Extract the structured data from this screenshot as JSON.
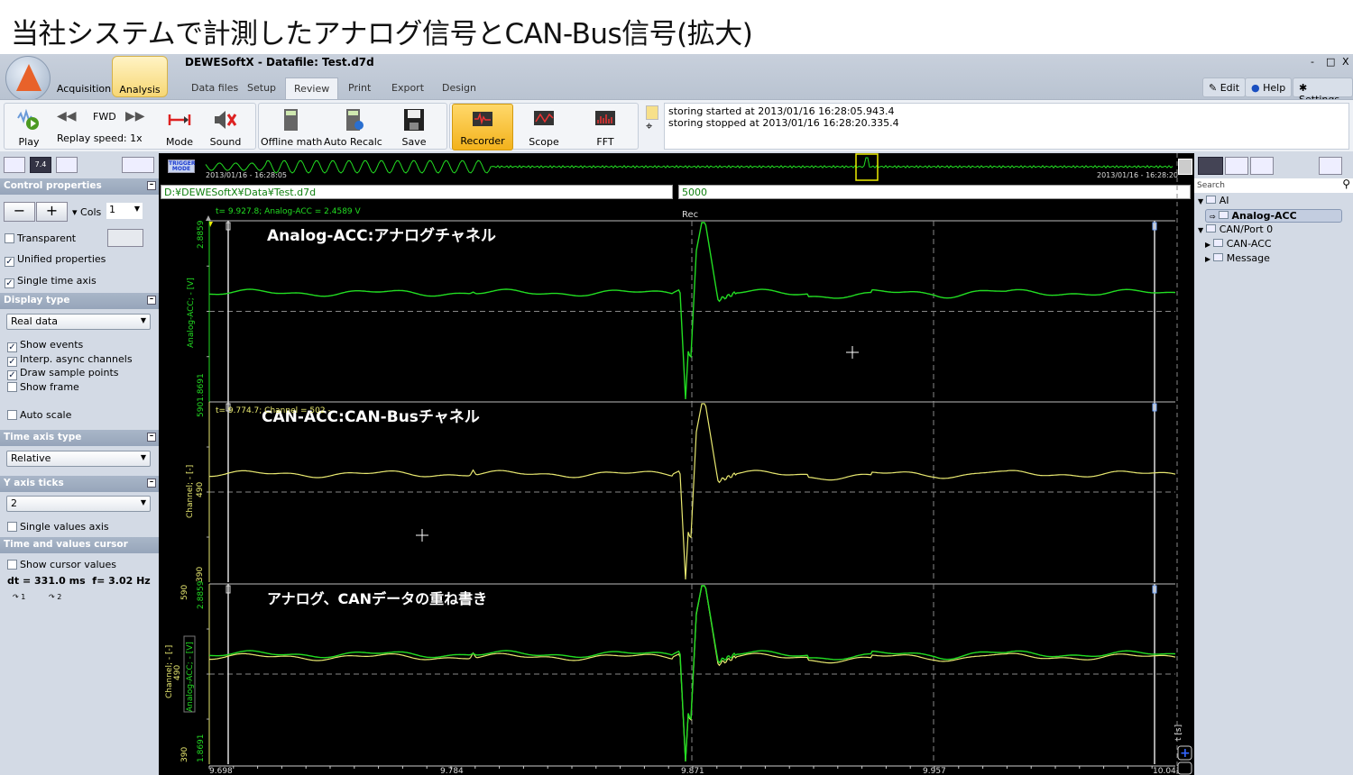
{
  "slide_title": "当社システムで計測したアナログ信号とCAN-Bus信号(拡大)",
  "app": {
    "title": "DEWESoftX - Datafile: Test.d7d",
    "modes": [
      "Acquisition",
      "Analysis"
    ],
    "tabs": [
      "Data files",
      "Setup",
      "Review",
      "Print",
      "Export",
      "Design"
    ],
    "active_tab": "Review",
    "window_controls": [
      "-",
      "□",
      "X"
    ],
    "right_buttons": [
      "Edit",
      "Help",
      "Settings"
    ]
  },
  "toolbar": {
    "play": "Play",
    "fwd": "FWD",
    "replay_speed": "Replay speed: 1x",
    "mode": "Mode",
    "sound": "Sound",
    "offline_math": "Offline math",
    "auto_recalc": "Auto Recalc",
    "save": "Save",
    "recorder": "Recorder",
    "scope": "Scope",
    "fft": "FFT"
  },
  "log": [
    "storing started at 2013/01/16 16:28:05.943.4",
    "storing stopped at 2013/01/16 16:28:20.335.4"
  ],
  "left": {
    "control_properties": "Control properties",
    "cols_label": "Cols",
    "cols_value": "1",
    "transparent": "Transparent",
    "unified": "Unified properties",
    "single_time": "Single time axis",
    "display_type": "Display type",
    "display_value": "Real data",
    "show_events": "Show events",
    "interp": "Interp. async channels",
    "draw_points": "Draw sample points",
    "show_frame": "Show frame",
    "auto_scale": "Auto scale",
    "time_axis_type": "Time axis type",
    "time_axis_value": "Relative",
    "y_axis_ticks": "Y axis ticks",
    "y_ticks_value": "2",
    "single_values": "Single values axis",
    "cursor_section": "Time and values cursor",
    "show_cursor": "Show cursor values",
    "dt": "dt = 331.0 ms  f= 3.02 Hz",
    "cursor1": "1",
    "cursor2": "2"
  },
  "checks": {
    "transparent": false,
    "unified": true,
    "single_time": true,
    "show_events": true,
    "interp": true,
    "draw_points": true,
    "show_frame": false,
    "auto_scale": false,
    "single_values": false,
    "show_cursor": false
  },
  "overview": {
    "trigger": "TRIGGER MODE",
    "start": "2013/01/16 - 16:28:05",
    "end": "2013/01/16 - 16:28:20"
  },
  "path": "D:¥DEWESoftX¥Data¥Test.d7d",
  "path_value": "5000",
  "panels": [
    {
      "title": "Analog-ACC:アナログチャネル",
      "readout": "t= 9.927.8; Analog-ACC = 2.4589 V",
      "ylabel": "Analog-ACC; - [V]",
      "ymax": "2.8859",
      "ymin": "5901.8691",
      "rec": "Rec"
    },
    {
      "title": "CAN-ACC:CAN-Busチャネル",
      "readout": "t= 9.774.7; Channel = 502 -",
      "ylabel": "Channel; - [-]",
      "ymid": "490",
      "ymin": "390"
    },
    {
      "title": "アナログ、CANデータの重ね書き",
      "ylabel1": "Channel; - [-]",
      "ylabel2": "Analog-ACC; - [V]",
      "ymax1": "590",
      "ymax2": "2.8859",
      "ymid": "490",
      "ymin1": "390",
      "ymin2": "1.8691"
    }
  ],
  "xaxis": {
    "ticks": [
      "9.698",
      "9.784",
      "9.871",
      "9.957",
      "10.043"
    ],
    "unit": "t [s]"
  },
  "colors": {
    "analog": "#22dd22",
    "can": "#e8e870",
    "accent": "#f5c030"
  },
  "channels": {
    "search": "Search",
    "tree": [
      {
        "label": "AI",
        "level": 0,
        "open": true
      },
      {
        "label": "Analog-ACC",
        "level": 1,
        "selected": true
      },
      {
        "label": "CAN/Port 0",
        "level": 0,
        "open": true
      },
      {
        "label": "CAN-ACC",
        "level": 1
      },
      {
        "label": "Message",
        "level": 1
      }
    ]
  }
}
